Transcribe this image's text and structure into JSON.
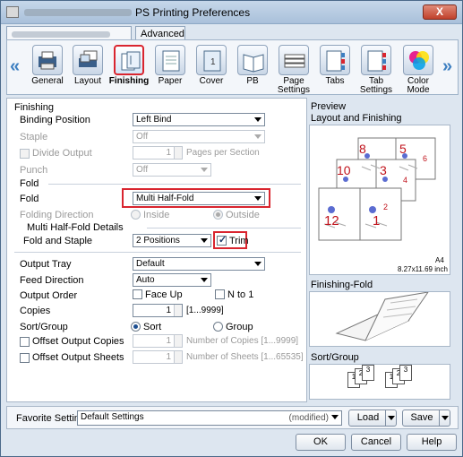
{
  "window": {
    "title": "PS Printing Preferences",
    "close_label": "X",
    "blurred_title_prefix": ""
  },
  "tabs": {
    "advanced": "Advanced"
  },
  "ribbon": {
    "items": [
      {
        "label": "General",
        "icon": "general-icon"
      },
      {
        "label": "Layout",
        "icon": "layout-icon"
      },
      {
        "label": "Finishing",
        "icon": "finishing-icon"
      },
      {
        "label": "Paper",
        "icon": "paper-icon"
      },
      {
        "label": "Cover",
        "icon": "cover-icon"
      },
      {
        "label": "PB",
        "icon": "pb-icon"
      },
      {
        "label": "Page Settings",
        "icon": "page-settings-icon"
      },
      {
        "label": "Tabs",
        "icon": "tabs-icon"
      },
      {
        "label": "Tab Settings",
        "icon": "tab-settings-icon"
      },
      {
        "label": "Color Mode",
        "icon": "color-mode-icon"
      }
    ],
    "selected": "Finishing",
    "left_arrow": "«",
    "right_arrow": "»"
  },
  "finishing": {
    "header": "Finishing",
    "binding_position_label": "Binding Position",
    "binding_position_value": "Left Bind",
    "staple_label": "Staple",
    "staple_value": "Off",
    "divide_output_label": "Divide Output",
    "divide_output_value": "1",
    "pages_per_section": "Pages per Section",
    "punch_label": "Punch",
    "punch_value": "Off",
    "fold_group": "Fold",
    "fold_label": "Fold",
    "fold_value": "Multi Half-Fold",
    "folding_direction_label": "Folding Direction",
    "inside_label": "Inside",
    "outside_label": "Outside",
    "multi_half_fold_details": "Multi Half-Fold Details",
    "fold_and_staple_label": "Fold and Staple",
    "fold_and_staple_value": "2 Positions",
    "trim_label": "Trim",
    "output_tray_label": "Output Tray",
    "output_tray_value": "Default",
    "feed_direction_label": "Feed Direction",
    "feed_direction_value": "Auto",
    "output_order_label": "Output Order",
    "face_up_label": "Face Up",
    "n_to_1_label": "N to 1",
    "copies_label": "Copies",
    "copies_value": "1",
    "copies_range": "[1...9999]",
    "sort_group_label": "Sort/Group",
    "sort_label": "Sort",
    "group_label": "Group",
    "offset_output_copies_label": "Offset Output Copies",
    "offset_copies_value": "1",
    "number_of_copies_label": "Number of Copies [1...9999]",
    "offset_output_sheets_label": "Offset Output Sheets",
    "offset_sheets_value": "1",
    "number_of_sheets_label": "Number of Sheets [1...65535]"
  },
  "preview": {
    "header": "Preview",
    "layout_and_finishing": "Layout and Finishing",
    "page_numbers": [
      "8",
      "5",
      "10",
      "3",
      "12",
      "1",
      "6",
      "4",
      "2"
    ],
    "paper_size": "A4",
    "paper_dims": "8.27x11.69 inch",
    "finishing_fold": "Finishing-Fold",
    "sort_group": "Sort/Group",
    "sort_pages": [
      "1",
      "2",
      "3"
    ]
  },
  "bottom": {
    "favorite_setting_label": "Favorite Setting",
    "favorite_value": "Default Settings",
    "modified": "(modified)",
    "load_label": "Load",
    "save_label": "Save"
  },
  "buttons": {
    "ok": "OK",
    "cancel": "Cancel",
    "help": "Help"
  },
  "colors": {
    "highlight": "#d9252f",
    "page_number": "#c0121b",
    "accent": "#3d7fc1"
  }
}
